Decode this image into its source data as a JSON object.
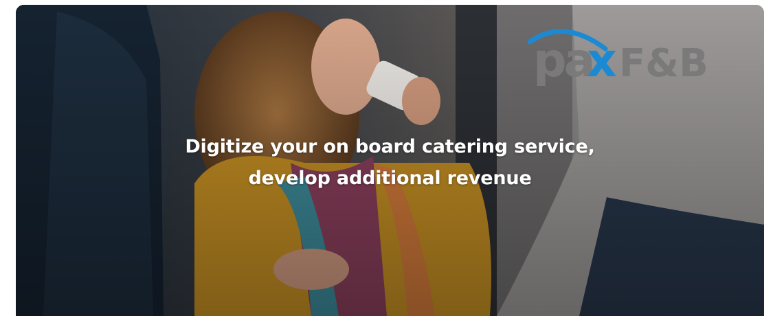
{
  "hero": {
    "headline_line1": "Digitize your on board catering service,",
    "headline_line2": "develop additional revenue"
  },
  "logo": {
    "pax": "pa",
    "x": "x",
    "suffix": "F&B"
  },
  "colors": {
    "logo_grey": "#7a7a7a",
    "logo_blue": "#1b8ad3",
    "headline": "#ffffff"
  }
}
